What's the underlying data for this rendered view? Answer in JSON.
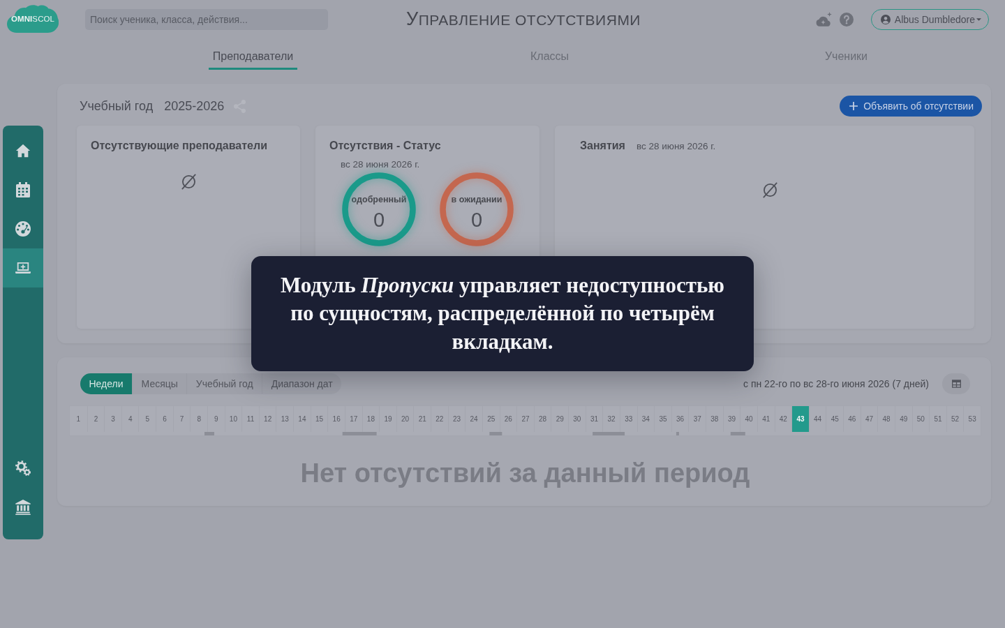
{
  "header": {
    "logo": "**OMNI**SCOL",
    "search": {
      "placeholder": "Поиск ученика, класса, действия..."
    },
    "title": "УПРАВЛЕНИЕ ОТСУТСТВИЯМИ",
    "user": {
      "name": "Albus Dumbledore"
    }
  },
  "tabs": [
    {
      "label": "Преподаватели",
      "selected": true
    },
    {
      "label": "Классы",
      "selected": false
    },
    {
      "label": "Ученики",
      "selected": false
    }
  ],
  "sidebar": {
    "top_items": [
      {
        "selected": false
      },
      {
        "selected": false
      },
      {
        "selected": false
      },
      {
        "selected": true
      }
    ],
    "bottom_items": [
      {
        "selected": false
      },
      {
        "selected": false
      }
    ]
  },
  "overview": {
    "year_label": "Учебный год",
    "year": "2025-2026",
    "declare_button": "Объявить об отсутствии",
    "cards": [
      {
        "kind": "empty",
        "title": "Отсутствующие преподаватели"
      },
      {
        "kind": "status",
        "title": "Отсутствия - Статус",
        "date": "вс 28 июня 2026 г.",
        "rings": [
          {
            "label": "одобренный",
            "value": "0",
            "color": "#1a9a8a"
          },
          {
            "label": "в ожидании",
            "value": "0",
            "color": "#c4674f"
          }
        ]
      },
      {
        "kind": "empty",
        "title": "Занятия",
        "date": "вс 28 июня 2026 г."
      }
    ]
  },
  "periods": {
    "modes": [
      {
        "label": "Недели",
        "selected": true
      },
      {
        "label": "Месяцы",
        "selected": false
      },
      {
        "label": "Учебный год",
        "selected": false
      },
      {
        "label": "Диапазон дат",
        "selected": false
      }
    ],
    "range": "с пн 22-го по вс 28-го июня 2026 (7 дней)",
    "weeks": [
      {
        "label": "1",
        "selected": false
      },
      {
        "label": "2",
        "selected": false
      },
      {
        "label": "3",
        "selected": false
      },
      {
        "label": "4",
        "selected": false
      },
      {
        "label": "5",
        "selected": false
      },
      {
        "label": "6",
        "selected": false
      },
      {
        "label": "7",
        "selected": false
      },
      {
        "label": "8",
        "selected": false
      },
      {
        "label": "9",
        "selected": false
      },
      {
        "label": "10",
        "selected": false
      },
      {
        "label": "11",
        "selected": false
      },
      {
        "label": "12",
        "selected": false
      },
      {
        "label": "13",
        "selected": false
      },
      {
        "label": "14",
        "selected": false
      },
      {
        "label": "15",
        "selected": false
      },
      {
        "label": "16",
        "selected": false
      },
      {
        "label": "17",
        "selected": false
      },
      {
        "label": "18",
        "selected": false
      },
      {
        "label": "19",
        "selected": false
      },
      {
        "label": "20",
        "selected": false
      },
      {
        "label": "21",
        "selected": false
      },
      {
        "label": "22",
        "selected": false
      },
      {
        "label": "23",
        "selected": false
      },
      {
        "label": "24",
        "selected": false
      },
      {
        "label": "25",
        "selected": false
      },
      {
        "label": "26",
        "selected": false
      },
      {
        "label": "27",
        "selected": false
      },
      {
        "label": "28",
        "selected": false
      },
      {
        "label": "29",
        "selected": false
      },
      {
        "label": "30",
        "selected": false
      },
      {
        "label": "31",
        "selected": false
      },
      {
        "label": "32",
        "selected": false
      },
      {
        "label": "33",
        "selected": false
      },
      {
        "label": "34",
        "selected": false
      },
      {
        "label": "35",
        "selected": false
      },
      {
        "label": "36",
        "selected": false
      },
      {
        "label": "37",
        "selected": false
      },
      {
        "label": "38",
        "selected": false
      },
      {
        "label": "39",
        "selected": false
      },
      {
        "label": "40",
        "selected": false
      },
      {
        "label": "41",
        "selected": false
      },
      {
        "label": "42",
        "selected": false
      },
      {
        "label": "43",
        "selected": true
      },
      {
        "label": "44",
        "selected": false
      },
      {
        "label": "45",
        "selected": false
      },
      {
        "label": "46",
        "selected": false
      },
      {
        "label": "47",
        "selected": false
      },
      {
        "label": "48",
        "selected": false
      },
      {
        "label": "49",
        "selected": false
      },
      {
        "label": "50",
        "selected": false
      },
      {
        "label": "51",
        "selected": false
      },
      {
        "label": "52",
        "selected": false
      },
      {
        "label": "53",
        "selected": false
      }
    ],
    "empty_message": "Нет отсутствий за данный период"
  },
  "tooltip": "Модуль *Пропуски* управляет недоступностью по сущностям, распределённой по четырём вкладкам."
}
